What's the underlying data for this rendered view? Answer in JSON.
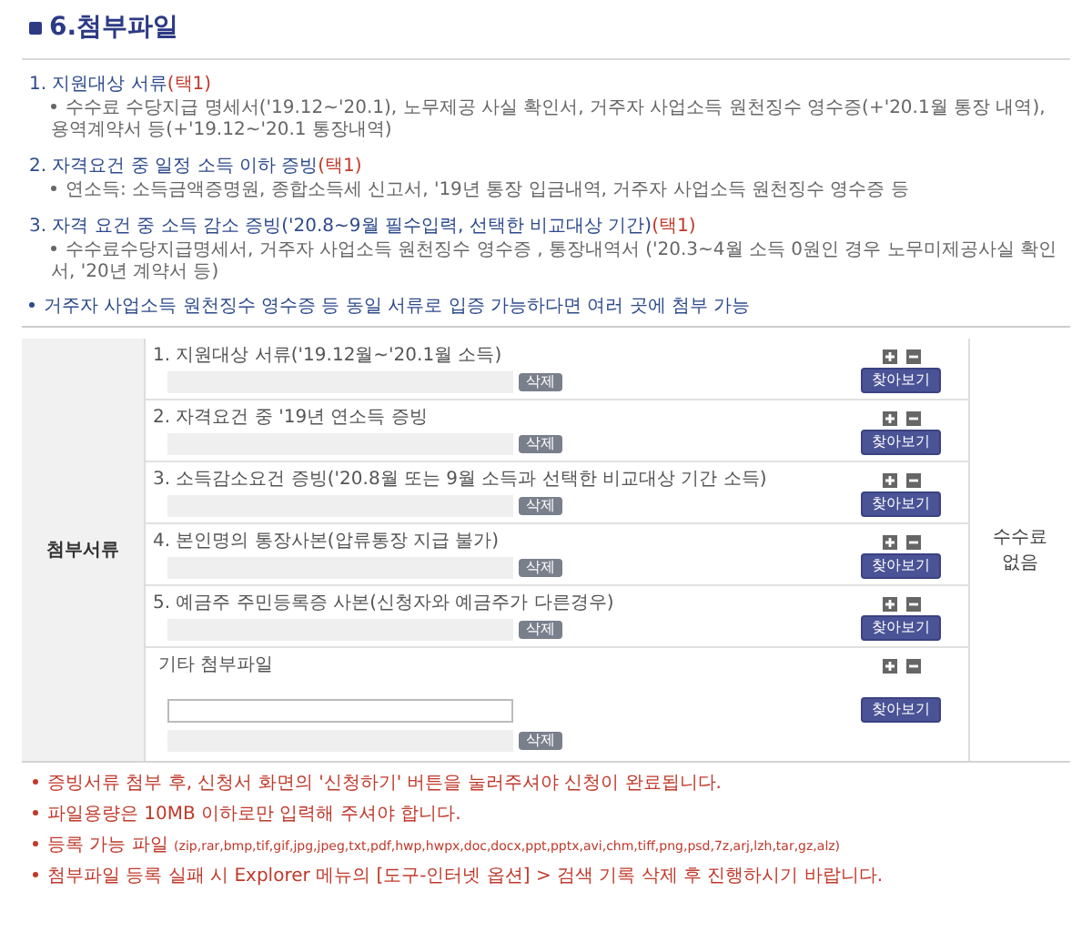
{
  "title": "6.첨부파일",
  "requirements": [
    {
      "label": "1. 지원대상 서류",
      "tag": "(택1)",
      "detail": "수수료 수당지급 명세서('19.12~'20.1), 노무제공 사실 확인서, 거주자 사업소득 원천징수 영수증(+'20.1월 통장 내역), 용역계약서 등(+'19.12~'20.1 통장내역)"
    },
    {
      "label": "2. 자격요건 중 일정 소득 이하 증빙",
      "tag": "(택1)",
      "detail": "연소득: 소득금액증명원, 종합소득세 신고서, '19년 통장 입금내역, 거주자 사업소득 원천징수 영수증 등"
    },
    {
      "label": "3. 자격 요건 중 소득 감소 증빙('20.8~9월 필수입력, 선택한 비교대상 기간)",
      "tag": "(택1)",
      "detail": "수수료수당지급명세서, 거주자 사업소득 원천징수 영수증 , 통장내역서 ('20.3~4월 소득 0원인 경우 노무미제공사실 확인서, '20년 계약서 등)"
    }
  ],
  "note": "거주자 사업소득 원천징수 영수증 등 동일 서류로 입증 가능하다면 여러 곳에 첨부 가능",
  "table": {
    "header": "첨부서류",
    "fee": "수수료 없음",
    "rows": [
      {
        "kind": "file",
        "label": "1. 지원대상 서류('19.12월~'20.1월 소득)",
        "delete": "삭제",
        "browse": "찾아보기"
      },
      {
        "kind": "file",
        "label": "2. 자격요건 중 '19년 연소득 증빙",
        "delete": "삭제",
        "browse": "찾아보기"
      },
      {
        "kind": "file",
        "label": "3. 소득감소요건 증빙('20.8월 또는 9월 소득과 선택한 비교대상 기간 소득)",
        "delete": "삭제",
        "browse": "찾아보기"
      },
      {
        "kind": "file",
        "label": "4. 본인명의 통장사본(압류통장 지급 불가)",
        "delete": "삭제",
        "browse": "찾아보기"
      },
      {
        "kind": "file",
        "label": "5. 예금주 주민등록증 사본(신청자와 예금주가 다른경우)",
        "delete": "삭제",
        "browse": "찾아보기"
      },
      {
        "kind": "other",
        "label": "기타 첨부파일",
        "delete": "삭제",
        "browse": "찾아보기"
      }
    ]
  },
  "notices": [
    {
      "text": "증빙서류 첨부 후, 신청서 화면의 '신청하기' 버튼을 눌러주셔야 신청이 완료됩니다."
    },
    {
      "text": "파일용량은 10MB 이하로만 입력해 주셔야 합니다."
    },
    {
      "text": "등록 가능 파일",
      "extensions": "(zip,rar,bmp,tif,gif,jpg,jpeg,txt,pdf,hwp,hwpx,doc,docx,ppt,pptx,avi,chm,tiff,png,psd,7z,arj,lzh,tar,gz,alz)"
    },
    {
      "text": "첨부파일 등록 실패 시 Explorer 메뉴의 [도구-인터넷 옵션] > 검색 기록 삭제 후 진행하시기 바랍니다."
    }
  ]
}
